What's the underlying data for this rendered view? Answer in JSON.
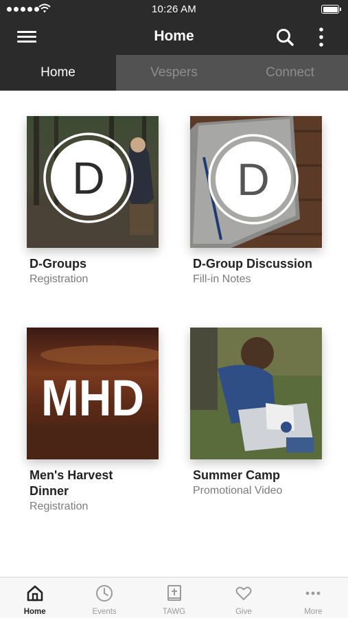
{
  "status_bar": {
    "time": "10:26 AM",
    "signal_icon": "cellular-signal-dots",
    "wifi_icon": "wifi-icon",
    "battery_icon": "battery-icon",
    "battery_level": 1.0
  },
  "nav": {
    "title": "Home",
    "menu_icon": "hamburger-menu-icon",
    "search_icon": "search-icon",
    "more_icon": "vertical-dots-icon"
  },
  "tabs": [
    {
      "label": "Home",
      "active": true
    },
    {
      "label": "Vespers",
      "active": false
    },
    {
      "label": "Connect",
      "active": false
    }
  ],
  "cards": [
    {
      "title": "D-Groups",
      "subtitle": "Registration",
      "badge_letter": "D"
    },
    {
      "title": "D-Group Discussion",
      "subtitle": "Fill-in Notes",
      "badge_letter": "D"
    },
    {
      "title": "Men's Harvest Dinner",
      "subtitle": "Registration",
      "image_text": "MHD"
    },
    {
      "title": "Summer Camp",
      "subtitle": "Promotional Video"
    }
  ],
  "bottom_nav": [
    {
      "label": "Home",
      "icon": "home-icon",
      "active": true
    },
    {
      "label": "Events",
      "icon": "clock-icon",
      "active": false
    },
    {
      "label": "TAWG",
      "icon": "bible-icon",
      "active": false
    },
    {
      "label": "Give",
      "icon": "heart-icon",
      "active": false
    },
    {
      "label": "More",
      "icon": "more-dots-icon",
      "active": false
    }
  ],
  "colors": {
    "header_bg": "#2b2b2b",
    "inactive_tab_bg": "#525252",
    "inactive_tab_text": "#8e8e8e",
    "bottom_bar_bg": "#f7f7f7",
    "subtitle_text": "#7b7b7b"
  }
}
